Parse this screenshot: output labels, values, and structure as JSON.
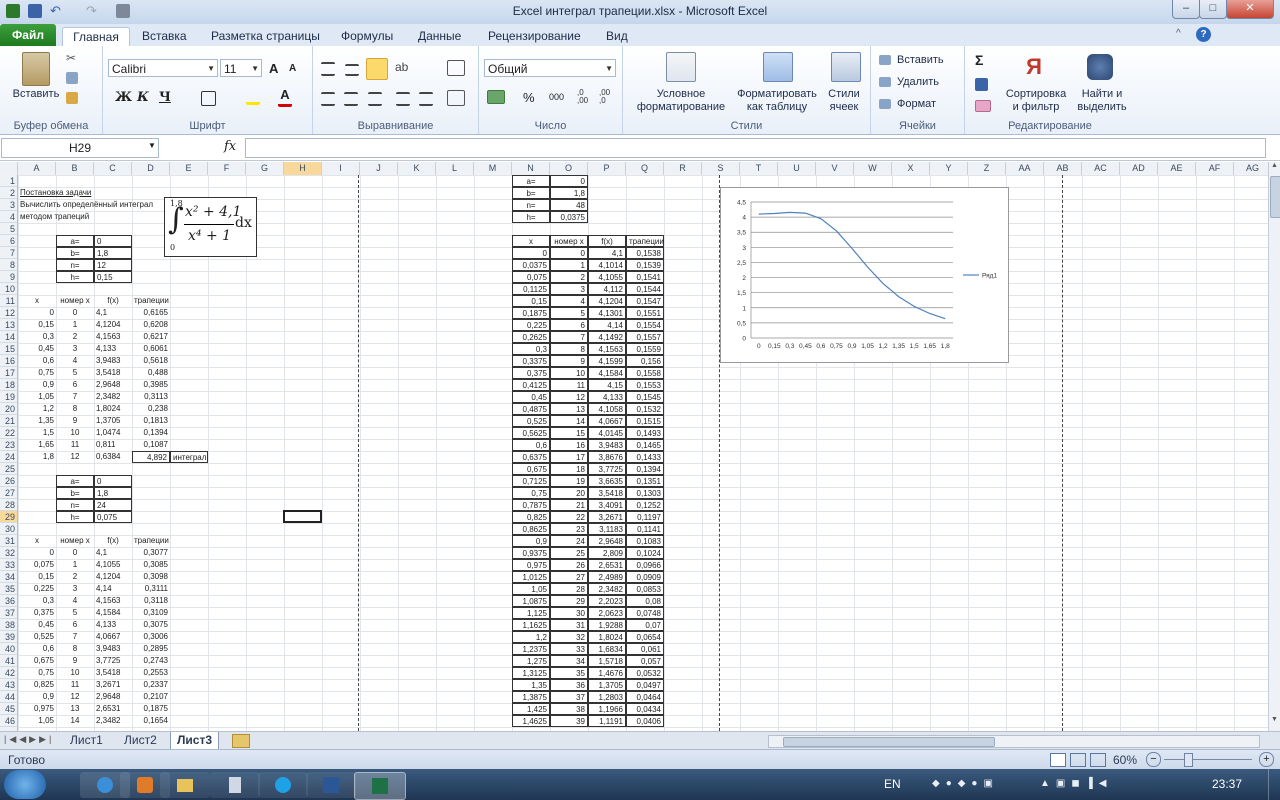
{
  "window": {
    "title": "Excel интеграл трапеции.xlsx  -  Microsoft Excel",
    "minimize": "–",
    "maximize": "□",
    "close": "✕"
  },
  "tabs": [
    "Файл",
    "Главная",
    "Вставка",
    "Разметка страницы",
    "Формулы",
    "Данные",
    "Рецензирование",
    "Вид"
  ],
  "ribbon": {
    "clipboard": {
      "label": "Буфер обмена",
      "paste": "Вставить"
    },
    "font": {
      "label": "Шрифт",
      "name": "Calibri",
      "size": "11",
      "bold": "Ж",
      "italic": "К",
      "underline": "Ч",
      "grow": "A",
      "shrink": "A"
    },
    "alignment": {
      "label": "Выравнивание"
    },
    "number": {
      "label": "Число",
      "format": "Общий",
      "percent": "%",
      "thousands": "000"
    },
    "styles": {
      "label": "Стили",
      "cond1": "Условное",
      "cond2": "форматирование",
      "fmt1": "Форматировать",
      "fmt2": "как таблицу",
      "cell1": "Стили",
      "cell2": "ячеек"
    },
    "cells": {
      "label": "Ячейки",
      "insert": "Вставить",
      "delete": "Удалить",
      "format": "Формат"
    },
    "editing": {
      "label": "Редактирование",
      "sigma": "Σ",
      "sort1": "Сортировка",
      "sort2": "и фильтр",
      "find1": "Найти и",
      "find2": "выделить"
    }
  },
  "formula_bar": {
    "name_box": "H29",
    "fx": "fx",
    "content": ""
  },
  "columns": [
    "A",
    "B",
    "C",
    "D",
    "E",
    "F",
    "G",
    "H",
    "I",
    "J",
    "K",
    "L",
    "M",
    "N",
    "O",
    "P",
    "Q",
    "R",
    "S",
    "T",
    "U",
    "V",
    "W",
    "X",
    "Y",
    "Z",
    "AA",
    "AB",
    "AC",
    "AD",
    "AE",
    "AF",
    "AG"
  ],
  "rows": [
    "1",
    "2",
    "3",
    "4",
    "5",
    "6",
    "7",
    "8",
    "9",
    "10",
    "11",
    "12",
    "13",
    "14",
    "15",
    "16",
    "17",
    "18",
    "19",
    "20",
    "21",
    "22",
    "23",
    "24",
    "25",
    "26",
    "27",
    "28",
    "29",
    "30",
    "31",
    "32",
    "33",
    "34",
    "35",
    "36",
    "37",
    "38",
    "39",
    "40",
    "41",
    "42",
    "43",
    "44",
    "45",
    "46"
  ],
  "sheet": {
    "task_title": "Постановка задачи",
    "task_line1": "Вычислить определённый интеграл",
    "task_line2": "методом трапеций",
    "formula": {
      "upper": "1,8",
      "lower": "0",
      "num": "x² + 4,1",
      "den": "x⁴ + 1",
      "dx": "dx"
    },
    "params1": [
      [
        "a=",
        "0"
      ],
      [
        "b=",
        "1,8"
      ],
      [
        "n=",
        "12"
      ],
      [
        "h=",
        "0,15"
      ]
    ],
    "headers": [
      "x",
      "номер x",
      "f(x)",
      "трапеции"
    ],
    "table1": [
      [
        "0",
        "0",
        "4,1",
        "0,6165"
      ],
      [
        "0,15",
        "1",
        "4,1204",
        "0,6208"
      ],
      [
        "0,3",
        "2",
        "4,1563",
        "0,6217"
      ],
      [
        "0,45",
        "3",
        "4,133",
        "0,6061"
      ],
      [
        "0,6",
        "4",
        "3,9483",
        "0,5618"
      ],
      [
        "0,75",
        "5",
        "3,5418",
        "0,488"
      ],
      [
        "0,9",
        "6",
        "2,9648",
        "0,3985"
      ],
      [
        "1,05",
        "7",
        "2,3482",
        "0,3113"
      ],
      [
        "1,2",
        "8",
        "1,8024",
        "0,238"
      ],
      [
        "1,35",
        "9",
        "1,3705",
        "0,1813"
      ],
      [
        "1,5",
        "10",
        "1,0474",
        "0,1394"
      ],
      [
        "1,65",
        "11",
        "0,811",
        "0,1087"
      ],
      [
        "1,8",
        "12",
        "0,6384",
        "4,892"
      ]
    ],
    "integral_label": "интеграл",
    "params2": [
      [
        "a=",
        "0"
      ],
      [
        "b=",
        "1,8"
      ],
      [
        "n=",
        "24"
      ],
      [
        "h=",
        "0,075"
      ]
    ],
    "table2": [
      [
        "0",
        "0",
        "4,1",
        "0,3077"
      ],
      [
        "0,075",
        "1",
        "4,1055",
        "0,3085"
      ],
      [
        "0,15",
        "2",
        "4,1204",
        "0,3098"
      ],
      [
        "0,225",
        "3",
        "4,14",
        "0,3111"
      ],
      [
        "0,3",
        "4",
        "4,1563",
        "0,3118"
      ],
      [
        "0,375",
        "5",
        "4,1584",
        "0,3109"
      ],
      [
        "0,45",
        "6",
        "4,133",
        "0,3075"
      ],
      [
        "0,525",
        "7",
        "4,0667",
        "0,3006"
      ],
      [
        "0,6",
        "8",
        "3,9483",
        "0,2895"
      ],
      [
        "0,675",
        "9",
        "3,7725",
        "0,2743"
      ],
      [
        "0,75",
        "10",
        "3,5418",
        "0,2553"
      ],
      [
        "0,825",
        "11",
        "3,2671",
        "0,2337"
      ],
      [
        "0,9",
        "12",
        "2,9648",
        "0,2107"
      ],
      [
        "0,975",
        "13",
        "2,6531",
        "0,1875"
      ],
      [
        "1,05",
        "14",
        "2,3482",
        "0,1654"
      ]
    ],
    "params3": [
      [
        "a=",
        "0"
      ],
      [
        "b=",
        "1,8"
      ],
      [
        "n=",
        "48"
      ],
      [
        "h=",
        "0,0375"
      ]
    ],
    "table3": [
      [
        "0",
        "0",
        "4,1",
        "0,1538"
      ],
      [
        "0,0375",
        "1",
        "4,1014",
        "0,1539"
      ],
      [
        "0,075",
        "2",
        "4,1055",
        "0,1541"
      ],
      [
        "0,1125",
        "3",
        "4,112",
        "0,1544"
      ],
      [
        "0,15",
        "4",
        "4,1204",
        "0,1547"
      ],
      [
        "0,1875",
        "5",
        "4,1301",
        "0,1551"
      ],
      [
        "0,225",
        "6",
        "4,14",
        "0,1554"
      ],
      [
        "0,2625",
        "7",
        "4,1492",
        "0,1557"
      ],
      [
        "0,3",
        "8",
        "4,1563",
        "0,1559"
      ],
      [
        "0,3375",
        "9",
        "4,1599",
        "0,156"
      ],
      [
        "0,375",
        "10",
        "4,1584",
        "0,1558"
      ],
      [
        "0,4125",
        "11",
        "4,15",
        "0,1553"
      ],
      [
        "0,45",
        "12",
        "4,133",
        "0,1545"
      ],
      [
        "0,4875",
        "13",
        "4,1058",
        "0,1532"
      ],
      [
        "0,525",
        "14",
        "4,0667",
        "0,1515"
      ],
      [
        "0,5625",
        "15",
        "4,0145",
        "0,1493"
      ],
      [
        "0,6",
        "16",
        "3,9483",
        "0,1465"
      ],
      [
        "0,6375",
        "17",
        "3,8676",
        "0,1433"
      ],
      [
        "0,675",
        "18",
        "3,7725",
        "0,1394"
      ],
      [
        "0,7125",
        "19",
        "3,6635",
        "0,1351"
      ],
      [
        "0,75",
        "20",
        "3,5418",
        "0,1303"
      ],
      [
        "0,7875",
        "21",
        "3,4091",
        "0,1252"
      ],
      [
        "0,825",
        "22",
        "3,2671",
        "0,1197"
      ],
      [
        "0,8625",
        "23",
        "3,1183",
        "0,1141"
      ],
      [
        "0,9",
        "24",
        "2,9648",
        "0,1083"
      ],
      [
        "0,9375",
        "25",
        "2,809",
        "0,1024"
      ],
      [
        "0,975",
        "26",
        "2,6531",
        "0,0966"
      ],
      [
        "1,0125",
        "27",
        "2,4989",
        "0,0909"
      ],
      [
        "1,05",
        "28",
        "2,3482",
        "0,0853"
      ],
      [
        "1,0875",
        "29",
        "2,2023",
        "0,08"
      ],
      [
        "1,125",
        "30",
        "2,0623",
        "0,0748"
      ],
      [
        "1,1625",
        "31",
        "1,9288",
        "0,07"
      ],
      [
        "1,2",
        "32",
        "1,8024",
        "0,0654"
      ],
      [
        "1,2375",
        "33",
        "1,6834",
        "0,061"
      ],
      [
        "1,275",
        "34",
        "1,5718",
        "0,057"
      ],
      [
        "1,3125",
        "35",
        "1,4676",
        "0,0532"
      ],
      [
        "1,35",
        "36",
        "1,3705",
        "0,0497"
      ],
      [
        "1,3875",
        "37",
        "1,2803",
        "0,0464"
      ],
      [
        "1,425",
        "38",
        "1,1966",
        "0,0434"
      ],
      [
        "1,4625",
        "39",
        "1,1191",
        "0,0406"
      ]
    ]
  },
  "chart_data": {
    "type": "line",
    "categories": [
      "0",
      "0,15",
      "0,3",
      "0,45",
      "0,6",
      "0,75",
      "0,9",
      "1,05",
      "1,2",
      "1,35",
      "1,5",
      "1,65",
      "1,8"
    ],
    "series": [
      {
        "name": "Ряд1",
        "values": [
          4.1,
          4.1204,
          4.1563,
          4.133,
          3.9483,
          3.5418,
          2.9648,
          2.3482,
          1.8024,
          1.3705,
          1.0474,
          0.811,
          0.6384
        ],
        "color": "#4f81bd"
      }
    ],
    "yticks": [
      "0",
      "0,5",
      "1",
      "1,5",
      "2",
      "2,5",
      "3",
      "3,5",
      "4",
      "4,5"
    ],
    "ylim": [
      0,
      4.5
    ],
    "grid": true,
    "legend": "right"
  },
  "sheet_tabs": [
    "Лист1",
    "Лист2",
    "Лист3"
  ],
  "status": {
    "ready": "Готово",
    "zoom": "60%",
    "minus": "−",
    "plus": "+"
  },
  "taskbar": {
    "lang": "EN",
    "time": "23:37"
  }
}
